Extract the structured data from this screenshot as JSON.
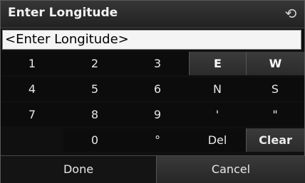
{
  "header": {
    "title": "Enter Longitude",
    "back_icon": "back-arrow-icon"
  },
  "entry": {
    "value": "<Enter Longitude>"
  },
  "keys": {
    "k1": "1",
    "k2": "2",
    "k3": "3",
    "k4": "4",
    "k5": "5",
    "k6": "6",
    "k7": "7",
    "k8": "8",
    "k9": "9",
    "k0": "0",
    "deg": "°",
    "E": "E",
    "W": "W",
    "N": "N",
    "S": "S",
    "minute": "'",
    "second": "\"",
    "del": "Del",
    "clear": "Clear"
  },
  "footer": {
    "done": "Done",
    "cancel": "Cancel"
  }
}
